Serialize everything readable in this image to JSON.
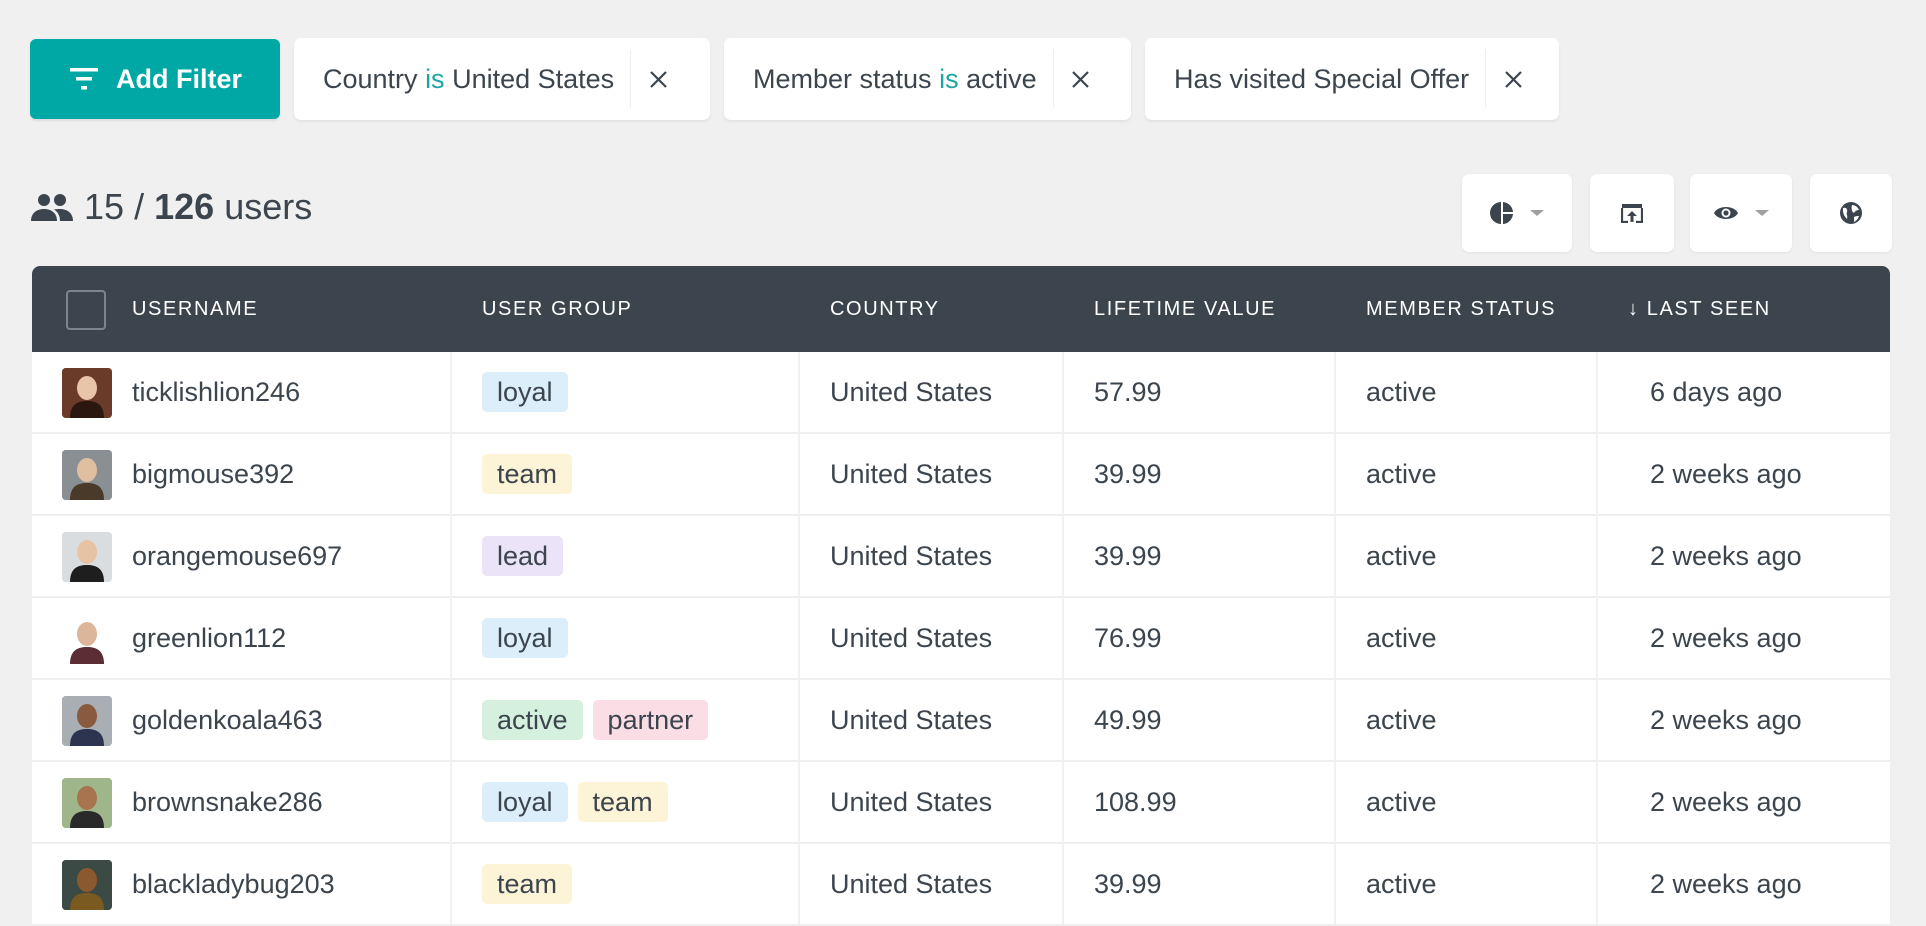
{
  "filter_bar": {
    "add_filter_label": "Add Filter",
    "filters": [
      {
        "field": "Country",
        "operator": "is",
        "value": "United States"
      },
      {
        "field": "Member status",
        "operator": "is",
        "value": "active"
      },
      {
        "field": "Has visited Special Offer",
        "operator": "",
        "value": ""
      }
    ]
  },
  "summary": {
    "shown": "15",
    "separator": "/",
    "total": "126",
    "unit": "users"
  },
  "toolbar": {
    "buttons": [
      {
        "icon": "pie-chart-icon",
        "has_dropdown": true
      },
      {
        "icon": "export-icon",
        "has_dropdown": false
      },
      {
        "icon": "eye-icon",
        "has_dropdown": true
      },
      {
        "icon": "globe-icon",
        "has_dropdown": false
      }
    ]
  },
  "colors": {
    "accent": "#00a8a5",
    "header_bg": "#3c454d",
    "text": "#3c454d",
    "page_bg": "#f0f0f0",
    "tag_loyal": "#dbeefa",
    "tag_team": "#fdf3d6",
    "tag_lead": "#ebe3f8",
    "tag_active": "#d6f0df",
    "tag_partner": "#fbdde6"
  },
  "table": {
    "columns": [
      "USERNAME",
      "USER GROUP",
      "COUNTRY",
      "LIFETIME VALUE",
      "MEMBER STATUS",
      "↓ LAST SEEN"
    ],
    "sorted_by": "LAST SEEN",
    "sort_direction": "descending",
    "rows": [
      {
        "username": "ticklishlion246",
        "groups": [
          "loyal"
        ],
        "country": "United States",
        "lifetime_value": "57.99",
        "member_status": "active",
        "last_seen": "6 days ago",
        "avatar": "woman-dark-hair"
      },
      {
        "username": "bigmouse392",
        "groups": [
          "team"
        ],
        "country": "United States",
        "lifetime_value": "39.99",
        "member_status": "active",
        "last_seen": "2 weeks ago",
        "avatar": "man-short-hair"
      },
      {
        "username": "orangemouse697",
        "groups": [
          "lead"
        ],
        "country": "United States",
        "lifetime_value": "39.99",
        "member_status": "active",
        "last_seen": "2 weeks ago",
        "avatar": "man-smiling"
      },
      {
        "username": "greenlion112",
        "groups": [
          "loyal"
        ],
        "country": "United States",
        "lifetime_value": "76.99",
        "member_status": "active",
        "last_seen": "2 weeks ago",
        "avatar": "man-beard"
      },
      {
        "username": "goldenkoala463",
        "groups": [
          "active",
          "partner"
        ],
        "country": "United States",
        "lifetime_value": "49.99",
        "member_status": "active",
        "last_seen": "2 weeks ago",
        "avatar": "man-suit"
      },
      {
        "username": "brownsnake286",
        "groups": [
          "loyal",
          "team"
        ],
        "country": "United States",
        "lifetime_value": "108.99",
        "member_status": "active",
        "last_seen": "2 weeks ago",
        "avatar": "man-curly-hair"
      },
      {
        "username": "blackladybug203",
        "groups": [
          "team"
        ],
        "country": "United States",
        "lifetime_value": "39.99",
        "member_status": "active",
        "last_seen": "2 weeks ago",
        "avatar": "man-bald"
      }
    ]
  }
}
